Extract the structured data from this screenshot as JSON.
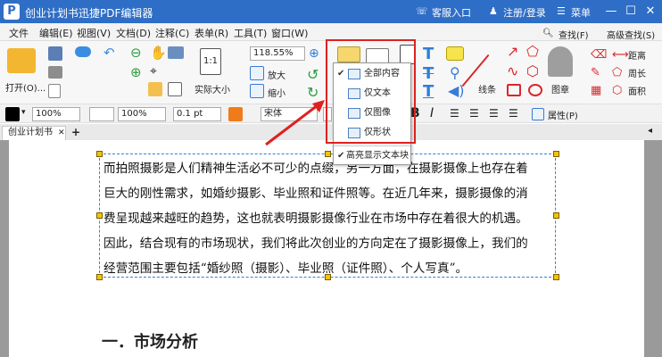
{
  "window": {
    "title": "创业计划书迅捷PDF编辑器",
    "logo": "P",
    "customer_service": "客服入口",
    "login": "注册/登录",
    "menu": "菜单"
  },
  "menubar": [
    "文件",
    "编辑(E)",
    "视图(V)",
    "文档(D)",
    "注释(C)",
    "表单(R)",
    "工具(T)",
    "窗口(W)"
  ],
  "ribbon": {
    "open_label": "打开(O)...",
    "zoom_value": "118.55%",
    "zoom_in": "放大",
    "zoom_out": "缩小",
    "actual_size": "实际大小",
    "line_label": "线条",
    "stamp_label": "图章",
    "find_label": "查找(F)",
    "advanced_find_label": "高级查找(S)",
    "distance_label": "距离",
    "perimeter_label": "周长",
    "area_label": "面积"
  },
  "formatbar": {
    "stroke_opacity": "100%",
    "fill_opacity": "100%",
    "line_width": "0.1 pt",
    "font_name": "宋体",
    "properties_label": "属性(P)"
  },
  "tab": {
    "doc_name": "创业计划书"
  },
  "document": {
    "lines": [
      "而拍照摄影是人们精神生活必不可少的点缀，另一方面，在摄影摄像上也存在着",
      "巨大的刚性需求，如婚纱摄影、毕业照和证件照等。在近几年来，摄影摄像的消",
      "费呈现越来越旺的趋势，这也就表明摄影摄像行业在市场中存在着很大的机遇。",
      "因此，结合现有的市场现状，我们将此次创业的方向定在了摄影摄像上，我们的",
      "经营范围主要包括“婚纱照（摄影）、毕业照（证件照）、个人写真”。"
    ],
    "heading": "一．市场分析"
  },
  "popup": {
    "items": [
      "全部内容",
      "仅文本",
      "仅图像",
      "仅形状"
    ],
    "highlight_label": "高亮显示文本块"
  },
  "colors": {
    "titlebar": "#2f6ec6",
    "annotation_red": "#e02020"
  }
}
